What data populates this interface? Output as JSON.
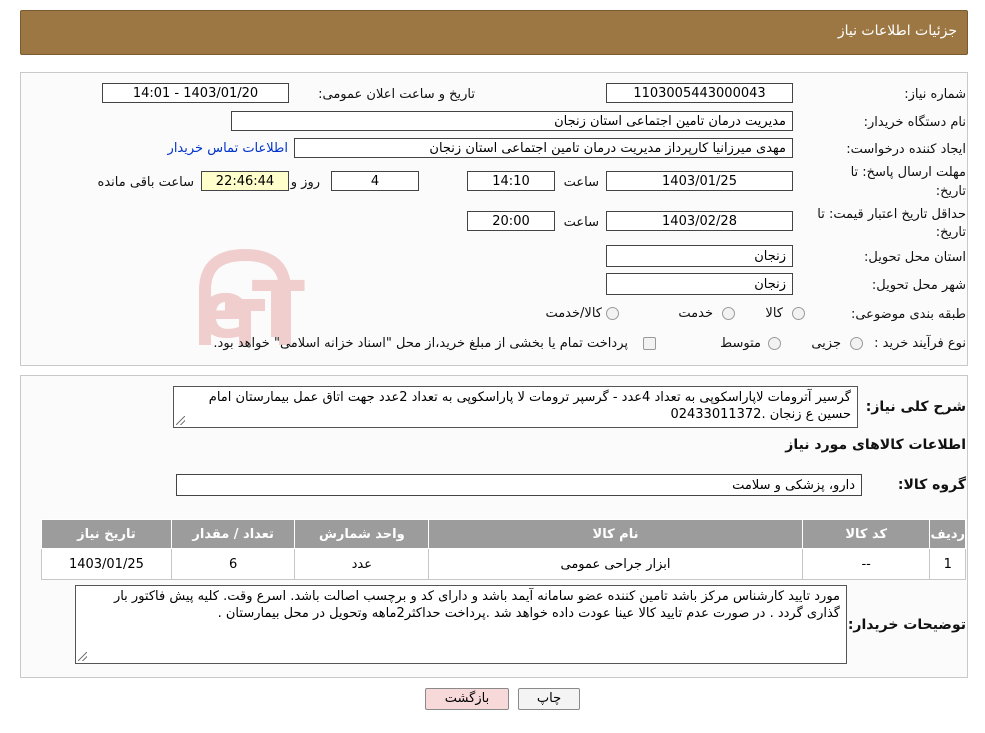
{
  "header": {
    "title": "جزئیات اطلاعات نیاز"
  },
  "form": {
    "need_number_label": "شماره نیاز:",
    "need_number": "1103005443000043",
    "announce_label": "تاریخ و ساعت اعلان عمومی:",
    "announce_value": "1403/01/20 - 14:01",
    "buyer_org_label": "نام دستگاه خریدار:",
    "buyer_org": "مدیریت درمان تامین اجتماعی استان زنجان",
    "creator_label": "ایجاد کننده درخواست:",
    "creator": "مهدی میرزانیا کارپرداز مدیریت درمان تامین اجتماعی استان زنجان",
    "contact_link": "اطلاعات تماس خریدار",
    "deadline_label_1": "مهلت ارسال پاسخ: تا",
    "deadline_label_2": "تاریخ:",
    "deadline_date": "1403/01/25",
    "time_label": "ساعت",
    "deadline_time": "14:10",
    "days_value": "4",
    "days_label": "روز و",
    "remaining_time": "22:46:44",
    "remaining_label": "ساعت باقی مانده",
    "price_validity_label_1": "حداقل تاریخ اعتبار قیمت: تا",
    "price_validity_label_2": "تاریخ:",
    "price_validity_date": "1403/02/28",
    "price_validity_time": "20:00",
    "province_label": "استان محل تحویل:",
    "province": "زنجان",
    "city_label": "شهر محل تحویل:",
    "city": "زنجان",
    "category_label": "طبقه بندی موضوعی:",
    "category_options": [
      "کالا",
      "خدمت",
      "کالا/خدمت"
    ],
    "process_label": "نوع فرآیند خرید :",
    "process_options": [
      "جزیی",
      "متوسط"
    ],
    "payment_note": "پرداخت تمام یا بخشی از مبلغ خرید،از محل \"اسناد خزانه اسلامی\" خواهد بود."
  },
  "summary": {
    "label": "شرح کلی نیاز:",
    "text": "گرسیر آترومات لاپاراسکوپی به تعداد 4عدد - گرسپر ترومات لا پاراسکوپی به تعداد 2عدد جهت اتاق عمل بیمارستان امام حسین ع زنجان .02433011372"
  },
  "goods_section": {
    "title": "اطلاعات کالاهای مورد نیاز",
    "group_label": "گروه کالا:",
    "group_value": "دارو، پزشکی و سلامت"
  },
  "table": {
    "headers": [
      "ردیف",
      "کد کالا",
      "نام کالا",
      "واحد شمارش",
      "تعداد / مقدار",
      "تاریخ نیاز"
    ],
    "rows": [
      [
        "1",
        "--",
        "ابزار جراحی عمومی",
        "عدد",
        "6",
        "1403/01/25"
      ]
    ]
  },
  "buyer_notes": {
    "label": "توضیحات خریدار:",
    "text": "مورد تایید کارشناس مرکز باشد تامین کننده عضو سامانه آیمد باشد و دارای کد  و برچسب اصالت باشد. اسرع وقت. کلیه پیش فاکتور بار گذاری گردد . در صورت عدم تایید کالا عینا عودت داده خواهد شد .پرداخت حداکثر2ماهه وتحویل در محل بیمارستان ."
  },
  "buttons": {
    "print": "چاپ",
    "back": "بازگشت"
  },
  "watermark": {
    "text": "AriaTender.neT",
    "color": "#cc3333"
  },
  "colors": {
    "header_bg": "#9c7743",
    "table_header_bg": "#9c9c9c",
    "remaining_bg": "#ffffcc",
    "back_button_bg": "#f8d9d9"
  }
}
